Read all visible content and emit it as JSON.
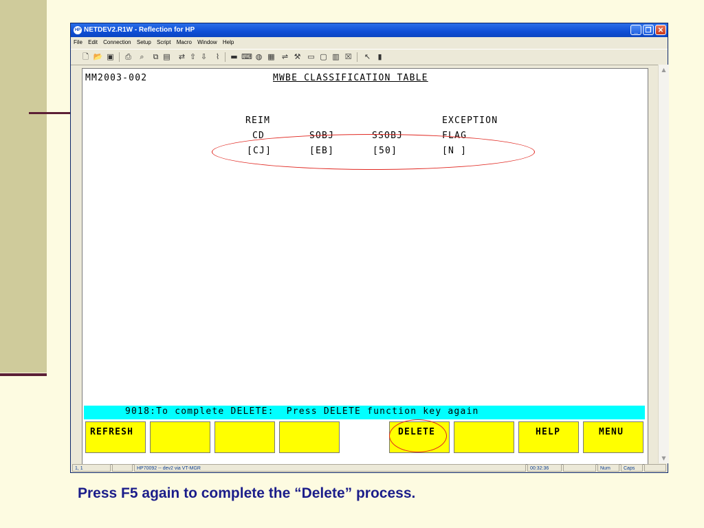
{
  "window": {
    "title": "NETDEV2.R1W - Reflection for HP",
    "icon_label": "HP",
    "menu": [
      "File",
      "Edit",
      "Connection",
      "Setup",
      "Script",
      "Macro",
      "Window",
      "Help"
    ]
  },
  "toolbar_icons": [
    "new-icon",
    "open-icon",
    "save-icon",
    "print-icon",
    "find-icon",
    "copy-icon",
    "paste-icon",
    "connect-icon",
    "send-file-icon",
    "receive-file-icon",
    "macro-icon",
    "display-icon",
    "keyboard-icon",
    "colors-icon",
    "terminal-icon",
    "transfer-icon",
    "tools-icon",
    "screen-icon",
    "dialog-icon",
    "chart-icon",
    "options-icon",
    "help-pointer-icon",
    "book-icon"
  ],
  "terminal": {
    "screen_id": "MM2003-002",
    "screen_title": "MWBE CLASSIFICATION TABLE",
    "columns": [
      {
        "header1": "REIM",
        "header2": "CD",
        "value": "[CJ]"
      },
      {
        "header1": "",
        "header2": "SOBJ",
        "value": "[EB]"
      },
      {
        "header1": "",
        "header2": "SSOBJ",
        "value": "[50]"
      },
      {
        "header1": "EXCEPTION",
        "header2": "FLAG",
        "value": "[N ]"
      }
    ],
    "message": "9018:To complete DELETE:  Press DELETE function key again",
    "function_keys": [
      "REFRESH",
      "",
      "",
      "",
      "",
      "DELETE",
      "",
      "HELP",
      "MENU"
    ]
  },
  "status": {
    "cursor": "1, 1",
    "connection": "HP70092 -- dev2 via VT-MGR",
    "time": "00:32:36",
    "num": "Num",
    "caps": "Caps"
  },
  "caption": "Press F5 again to complete the “Delete” process.",
  "colors": {
    "accent": "#1b1d8a",
    "slide_band": "#cfcb9b",
    "message_bar": "#00ffff",
    "function_key": "#ffff00",
    "annotation": "#e0261f"
  }
}
